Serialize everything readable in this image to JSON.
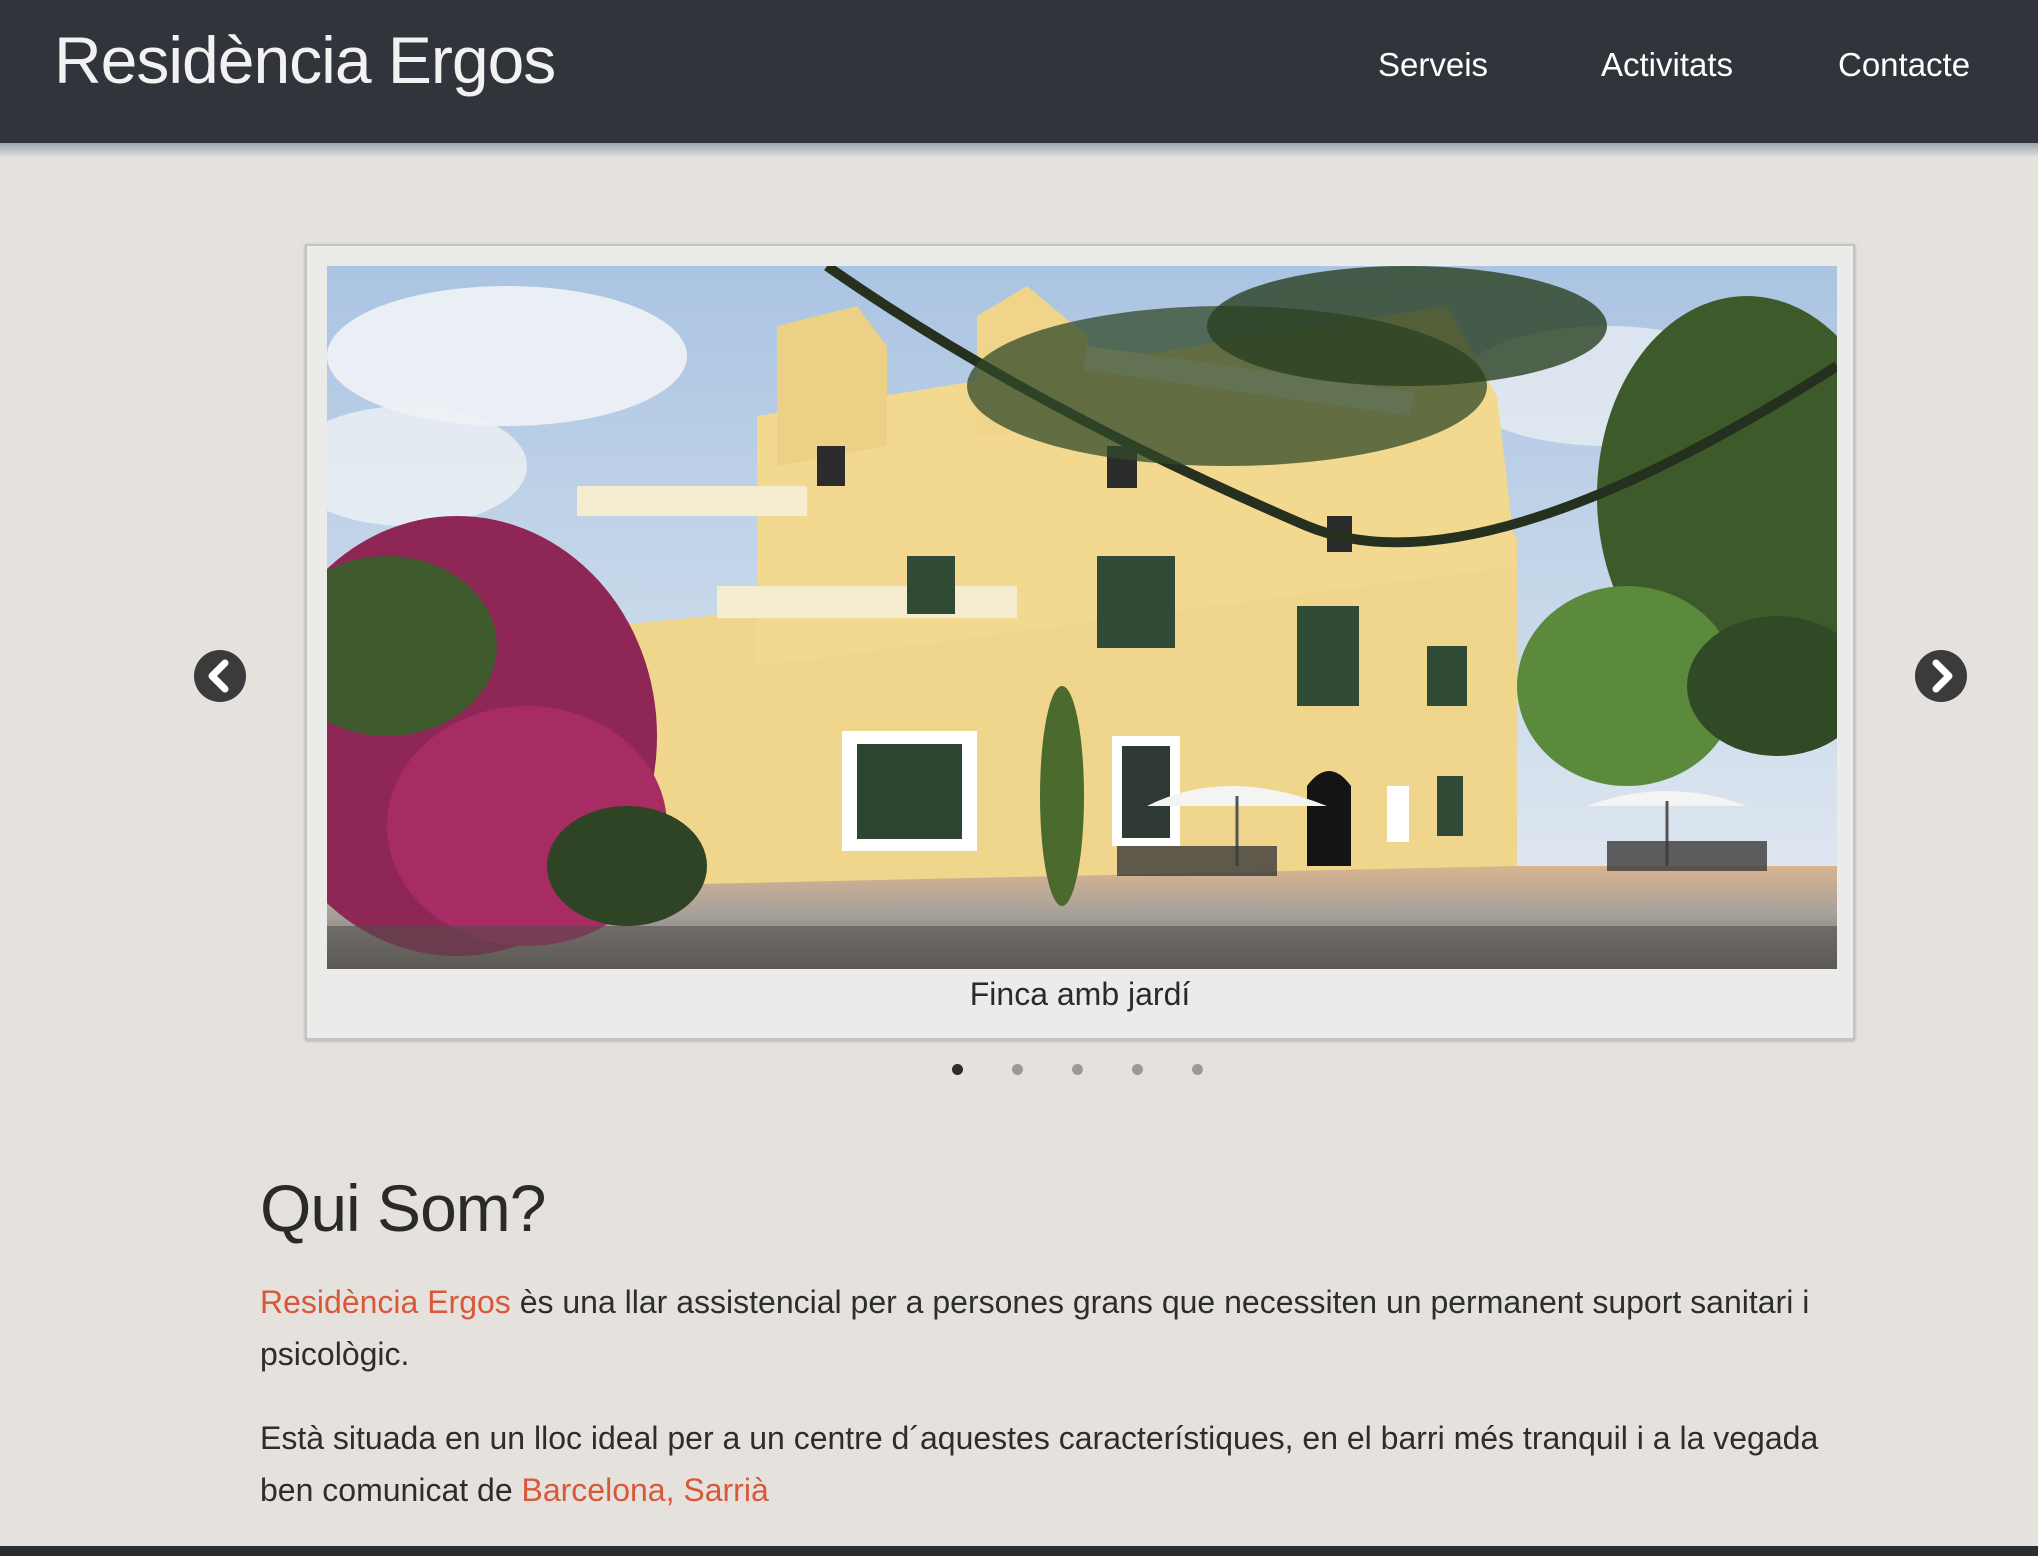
{
  "header": {
    "brand": "Residència Ergos",
    "nav": {
      "serveis": "Serveis",
      "activitats": "Activitats",
      "contacte": "Contacte"
    }
  },
  "carousel": {
    "caption": "Finca amb jardí",
    "slide_count": 5,
    "active_index": 0,
    "prev_icon": "chevron-left-icon",
    "next_icon": "chevron-right-icon"
  },
  "about": {
    "title": "Qui Som?",
    "p1_link": "Residència Ergos",
    "p1_text": " ès una llar assistencial per a persones grans que necessiten un permanent suport sanitari i psicològic.",
    "p2_text": "Està situada en un lloc ideal per a un centre d´aquestes característiques, en el barri més tranquil i a la vegada ben comunicat de ",
    "p2_link": "Barcelona, Sarrià"
  },
  "colors": {
    "header_bg": "#32343c",
    "page_bg": "#e5e2de",
    "accent": "#d9583a"
  }
}
